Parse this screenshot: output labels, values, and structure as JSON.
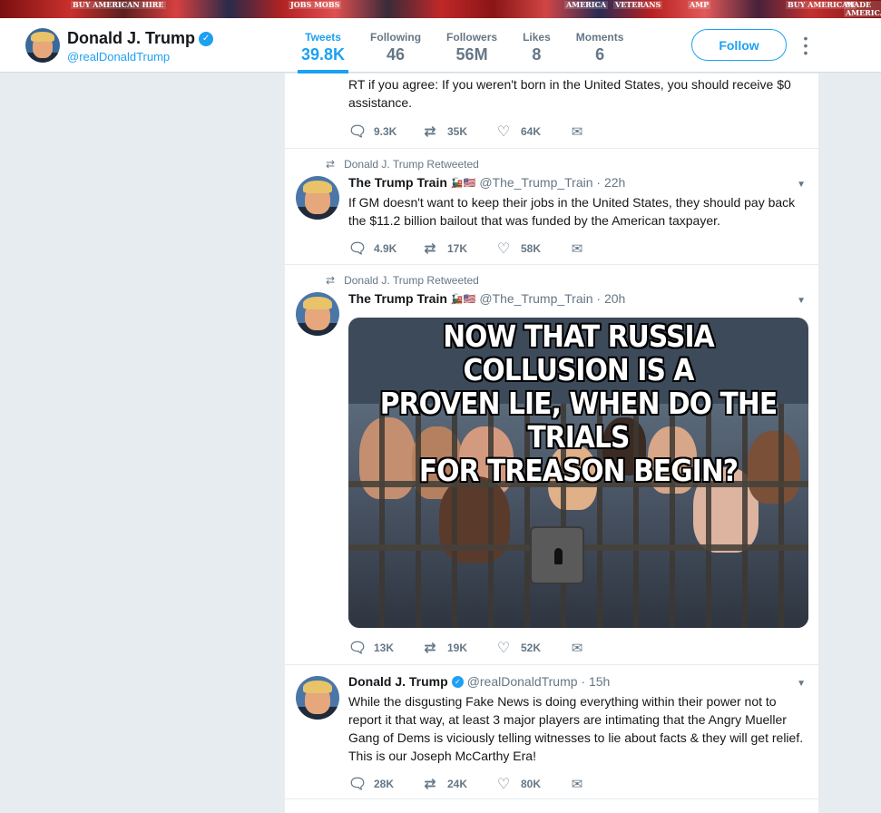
{
  "header": {
    "name": "Donald J. Trump",
    "handle": "@realDonaldTrump",
    "stats": [
      {
        "label": "Tweets",
        "value": "39.8K",
        "active": true
      },
      {
        "label": "Following",
        "value": "46"
      },
      {
        "label": "Followers",
        "value": "56M"
      },
      {
        "label": "Likes",
        "value": "8"
      },
      {
        "label": "Moments",
        "value": "6"
      }
    ],
    "follow_label": "Follow"
  },
  "banner": {
    "signs": [
      "BUY AMERICAN HIRE",
      "JOBS MOBS",
      "AMERICA",
      "VETERANS",
      "AMP",
      "BUY AMERICAN",
      "MADE AMERICA"
    ]
  },
  "tweets": [
    {
      "text": "RT if you agree: If you weren't born in the United States, you should receive $0 assistance.",
      "replies": "9.3K",
      "retweets": "35K",
      "likes": "64K"
    },
    {
      "context": "Donald J. Trump Retweeted",
      "name": "The Trump Train",
      "flags": "🚂🇺🇸",
      "handle": "@The_Trump_Train · 22h",
      "text": "If GM doesn't want to keep their jobs in the United States, they should pay back the $11.2 billion bailout that was funded by the American taxpayer.",
      "replies": "4.9K",
      "retweets": "17K",
      "likes": "58K"
    },
    {
      "context": "Donald J. Trump Retweeted",
      "name": "The Trump Train",
      "flags": "🚂🇺🇸",
      "handle": "@The_Trump_Train · 20h",
      "image_text": [
        "NOW THAT RUSSIA COLLUSION IS A",
        "PROVEN LIE, WHEN DO THE TRIALS",
        "FOR TREASON BEGIN?"
      ],
      "replies": "13K",
      "retweets": "19K",
      "likes": "52K"
    },
    {
      "name": "Donald J. Trump",
      "handle": "@realDonaldTrump · 15h",
      "text": "While the disgusting Fake News is doing everything within their power not to report it that way, at least 3 major players are intimating that the Angry Mueller Gang of Dems is viciously telling witnesses to lie about facts & they will get relief. This is our Joseph McCarthy Era!",
      "replies": "28K",
      "retweets": "24K",
      "likes": "80K"
    }
  ],
  "icons": {
    "reply": "speech-bubble",
    "retweet": "retweet-arrows",
    "like": "heart-outline",
    "message": "envelope"
  },
  "colors": {
    "accent": "#1da1f2",
    "muted": "#657786",
    "background": "#e6ecf0"
  }
}
